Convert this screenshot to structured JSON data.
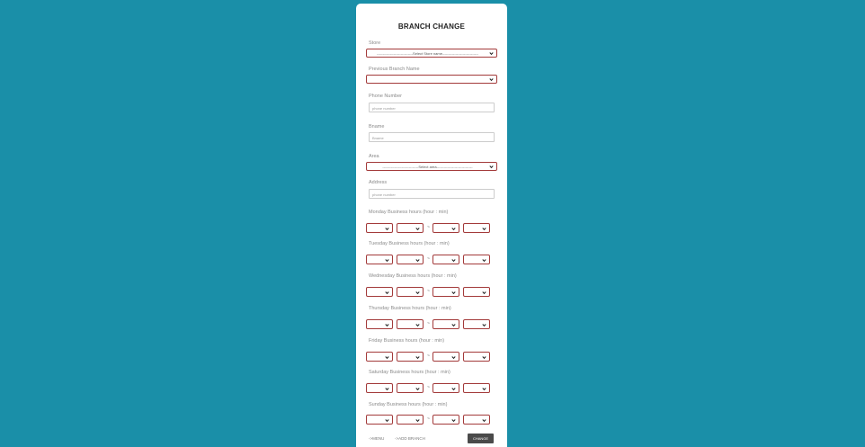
{
  "form": {
    "title": "BRANCH CHANGE",
    "store": {
      "label": "Store",
      "selected": "------------------------------Select Store name------------------------------"
    },
    "previous_branch": {
      "label": "Previous Branch Name",
      "selected": ""
    },
    "phone": {
      "label": "Phone Number",
      "placeholder": "phone number"
    },
    "bname": {
      "label": "Bname",
      "placeholder": "Bname"
    },
    "area": {
      "label": "Area",
      "selected": "------------------------------Select area------------------------------"
    },
    "address": {
      "label": "Address",
      "placeholder": "phone number"
    },
    "hours": [
      {
        "label": "Monday Business hours (hour : min)"
      },
      {
        "label": "Tuesday Business hours (hour : min)"
      },
      {
        "label": "Wednesday Business hours (hour : min)"
      },
      {
        "label": "Thursday Business hours (hour : min)"
      },
      {
        "label": "Friday Business hours (hour : min)"
      },
      {
        "label": "Saturday Business hours (hour : min)"
      },
      {
        "label": "Sunday Business hours (hour : min)"
      }
    ],
    "hours_separator": "~",
    "footer": {
      "menu_link": "->MENU",
      "add_branch_link": "->ADD BRANCH",
      "change_button": "CHANGE"
    }
  },
  "colors": {
    "background": "#1a8fa8",
    "select_border": "#a33a3a",
    "button": "#4a4a4a"
  }
}
